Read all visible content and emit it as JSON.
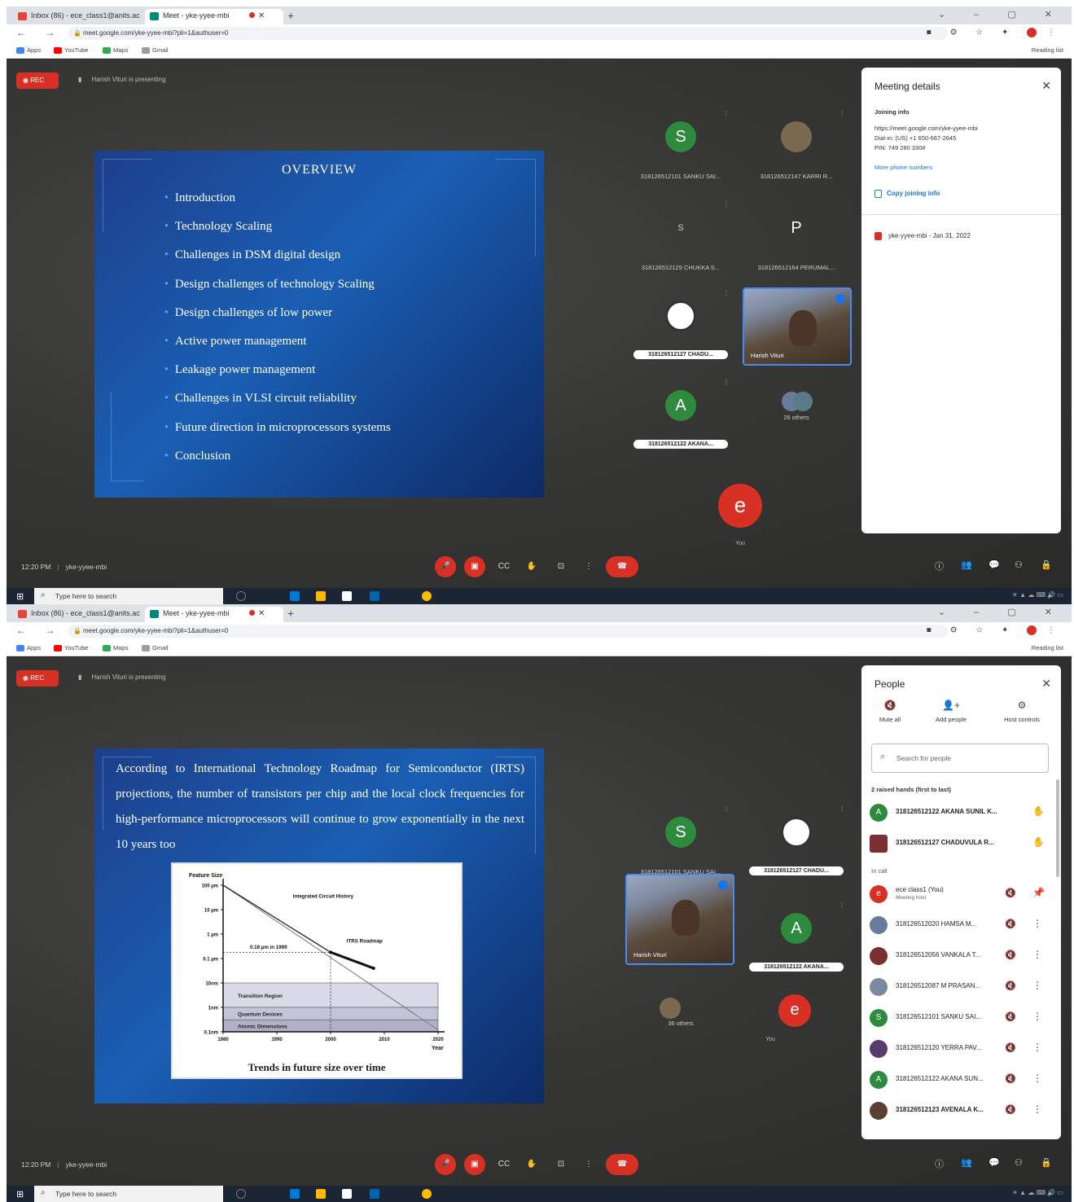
{
  "browser": {
    "tabs": [
      {
        "label": "Inbox (86) - ece_class1@anits.ac",
        "active": false
      },
      {
        "label": "Meet - yke-yyee-mbi",
        "active": true
      }
    ],
    "url": "meet.google.com/yke-yyee-mbi?pli=1&authuser=0",
    "bookmarks": [
      "Apps",
      "YouTube",
      "Maps",
      "Gmail"
    ],
    "reading_list": "Reading list"
  },
  "meet": {
    "rec_label": "REC",
    "presenting": "Harish Vituri is presenting",
    "meeting_code": "yke-yyee-mbi",
    "you_label": "You"
  },
  "shot1": {
    "slide": {
      "title": "OVERVIEW",
      "bullets": [
        "Introduction",
        "Technology Scaling",
        "Challenges in DSM digital design",
        "Design challenges of technology Scaling",
        "Design challenges of low power",
        "Active power management",
        "Leakage power management",
        "Challenges in VLSI circuit reliability",
        "Future direction in microprocessors systems",
        "Conclusion"
      ]
    },
    "tiles": [
      {
        "initial": "S",
        "name": "318126512101 SANKU SAI...",
        "color": "#2e8b3e"
      },
      {
        "initial": "",
        "name": "318126512147 KARRI R...",
        "color": "#7a6a50"
      },
      {
        "initial": "S",
        "name": "318126512129 CHUKKA S...",
        "color": "#3a3a38"
      },
      {
        "initial": "P",
        "name": "318126512164 PERUMAL...",
        "color": "#3a3a38"
      },
      {
        "initial": "",
        "name": "318126512127 CHADU...",
        "color": "#ffffff"
      },
      {
        "initial": "A",
        "name": "318126512122 AKANA...",
        "color": "#2e8b3e"
      }
    ],
    "video_name": "Harish Vituri",
    "others": "26 others",
    "time": "12:20 PM",
    "panel": {
      "title": "Meeting details",
      "joining_info": "Joining info",
      "link": "https://meet.google.com/yke-yyee-mbi",
      "dial": "Dial-in: (US) +1 650-667-2645",
      "pin": "PIN: 749 280 330#",
      "more_numbers": "More phone numbers",
      "copy": "Copy joining info",
      "calendar": "yke-yyee-mbi - Jan 31, 2022"
    }
  },
  "shot2": {
    "slide": {
      "paragraph": "According to International Technology Roadmap for Semiconductor (IRTS) projections, the number of transistors per chip and the local clock frequencies for high-performance microprocessors will continue to grow exponentially in the next 10 years too"
    },
    "chart_data": {
      "type": "line",
      "title": "",
      "xlabel": "Year",
      "ylabel": "Feature Size",
      "x_ticks": [
        "1980",
        "1990",
        "2000",
        "2010",
        "2020"
      ],
      "y_ticks": [
        "100 µm",
        "10 µm",
        "1 µm",
        "0.1 µm",
        "10nm",
        "1nm",
        "0.1nm"
      ],
      "series": [
        {
          "name": "Integrated Circuit History",
          "x": [
            1980,
            2000
          ],
          "y": [
            100,
            0.18
          ]
        },
        {
          "name": "ITRS Roadmap",
          "x": [
            2000,
            2008
          ],
          "y": [
            0.18,
            0.04
          ]
        }
      ],
      "annotations": [
        "0.18 µm in 1999"
      ],
      "regions": [
        "Transition Region",
        "Quantum Devices",
        "Atomic Dimensions"
      ],
      "caption": "Trends in future size over time"
    },
    "tiles": [
      {
        "initial": "S",
        "name": "318126512101 SANKU SAI...",
        "color": "#2e8b3e"
      },
      {
        "initial": "",
        "name": "318126512127 CHADU...",
        "color": "#ffffff"
      },
      {
        "initial": "A",
        "name": "318126512122 AKANA...",
        "color": "#2e8b3e"
      }
    ],
    "video_name": "Harish Vituri",
    "others": "36 others",
    "time": "12:20 PM",
    "panel": {
      "title": "People",
      "actions": [
        "Mute all",
        "Add people",
        "Host controls"
      ],
      "search_placeholder": "Search for people",
      "raised_hands": "2 raised hands (first to last)",
      "in_call": "In call",
      "raised": [
        {
          "initial": "A",
          "name": "318126512122 AKANA SUNIL K...",
          "color": "#2e8b3e"
        },
        {
          "initial": "",
          "name": "318126512127 CHADUVULA R...",
          "color": "#7a3030"
        }
      ],
      "people": [
        {
          "initial": "e",
          "name": "ece class1 (You)",
          "sub": "Meeting host",
          "color": "#d93025"
        },
        {
          "initial": "",
          "name": "318126512020 HAMSA M...",
          "sub": "",
          "color": "#6a7a9a"
        },
        {
          "initial": "",
          "name": "318126512056 VANKALA T...",
          "sub": "",
          "color": "#7a3030"
        },
        {
          "initial": "",
          "name": "318126512087 M PRASAN...",
          "sub": "",
          "color": "#7a8aa0"
        },
        {
          "initial": "S",
          "name": "318126512101 SANKU SAI...",
          "sub": "",
          "color": "#2e8b3e"
        },
        {
          "initial": "",
          "name": "318126512120 YERRA PAV...",
          "sub": "",
          "color": "#5a3a6a"
        },
        {
          "initial": "A",
          "name": "318126512122 AKANA SUN...",
          "sub": "",
          "color": "#2e8b3e"
        },
        {
          "initial": "",
          "name": "318126512123 AVENALA K...",
          "sub": "",
          "color": "#5a4030"
        }
      ]
    }
  },
  "taskbar": {
    "search": "Type here to search"
  }
}
